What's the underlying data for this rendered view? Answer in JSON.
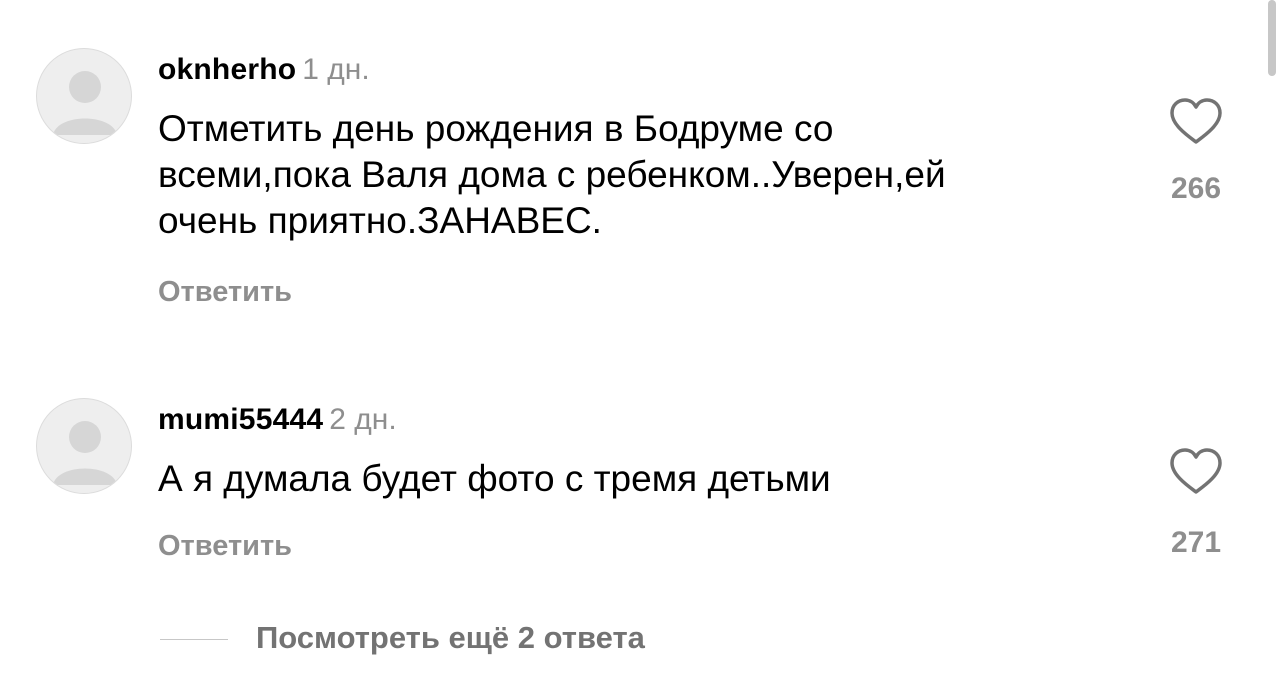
{
  "comments": [
    {
      "username": "oknherho",
      "time": "1 дн.",
      "text_lines": [
        "Отметить день рождения в Бодруме со",
        "всеми,пока Валя дома с ребенком..Уверен,ей",
        "очень приятно.ЗАНАВЕС."
      ],
      "reply_label": "Ответить",
      "like_count": "266"
    },
    {
      "username": "mumi55444",
      "time": "2 дн.",
      "text_lines": [
        "А я думала будет фото с тремя детьми"
      ],
      "reply_label": "Ответить",
      "like_count": "271"
    }
  ],
  "view_replies_label": "Посмотреть ещё 2 ответа",
  "icons": {
    "avatar": "default-avatar-icon",
    "like": "heart-outline-icon"
  },
  "colors": {
    "text": "#000000",
    "secondary": "#8e8e8e",
    "view_replies": "#737373"
  }
}
